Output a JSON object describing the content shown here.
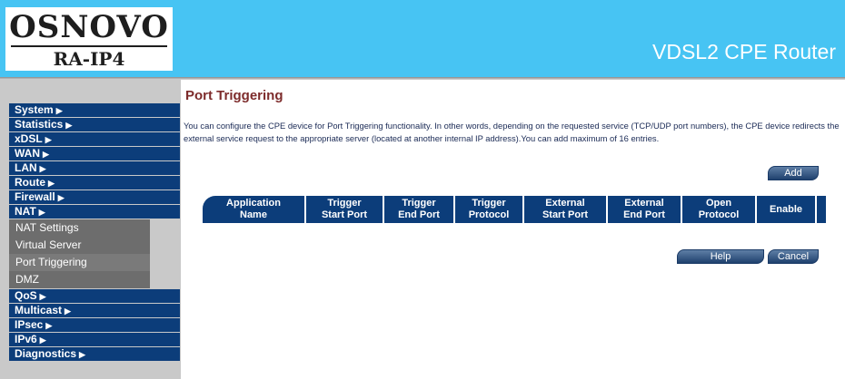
{
  "header": {
    "brand": "OSNOVO",
    "model": "RA-IP4",
    "title": "VDSL2 CPE Router"
  },
  "sidebar": {
    "items": [
      {
        "label": "System",
        "arrow": "▶"
      },
      {
        "label": "Statistics",
        "arrow": "▶"
      },
      {
        "label": "xDSL",
        "arrow": "▶"
      },
      {
        "label": "WAN",
        "arrow": "▶"
      },
      {
        "label": "LAN",
        "arrow": "▶"
      },
      {
        "label": "Route",
        "arrow": "▶"
      },
      {
        "label": "Firewall",
        "arrow": "▶"
      },
      {
        "label": "NAT",
        "arrow": "▶"
      }
    ],
    "nat_sub": [
      {
        "label": "NAT Settings"
      },
      {
        "label": "Virtual Server"
      },
      {
        "label": "Port Triggering"
      },
      {
        "label": "DMZ"
      }
    ],
    "items_after": [
      {
        "label": "QoS",
        "arrow": "▶"
      },
      {
        "label": "Multicast",
        "arrow": "▶"
      },
      {
        "label": "IPsec",
        "arrow": "▶"
      },
      {
        "label": "IPv6",
        "arrow": "▶"
      },
      {
        "label": "Diagnostics",
        "arrow": "▶"
      }
    ]
  },
  "main": {
    "title": "Port Triggering",
    "description": "You can configure the CPE device for Port Triggering functionality. In other words, depending on the requested service (TCP/UDP port numbers), the CPE device redirects the external service request to the appropriate server (located at another internal IP address).You can add maximum of 16 entries.",
    "add_label": "Add",
    "help_label": "Help",
    "cancel_label": "Cancel",
    "columns": [
      {
        "line1": "Application",
        "line2": "Name"
      },
      {
        "line1": "Trigger",
        "line2": "Start Port"
      },
      {
        "line1": "Trigger",
        "line2": "End Port"
      },
      {
        "line1": "Trigger",
        "line2": "Protocol"
      },
      {
        "line1": "External",
        "line2": "Start Port"
      },
      {
        "line1": "External",
        "line2": "End Port"
      },
      {
        "line1": "Open",
        "line2": "Protocol"
      },
      {
        "line1": "Enable",
        "line2": ""
      }
    ]
  },
  "colors": {
    "header_bg": "#47c4f3",
    "nav_blue": "#0c3d7a",
    "submenu_gray": "#6d6d6d",
    "sidebar_gray": "#c9c9c9",
    "title_red": "#7d2b2b"
  }
}
